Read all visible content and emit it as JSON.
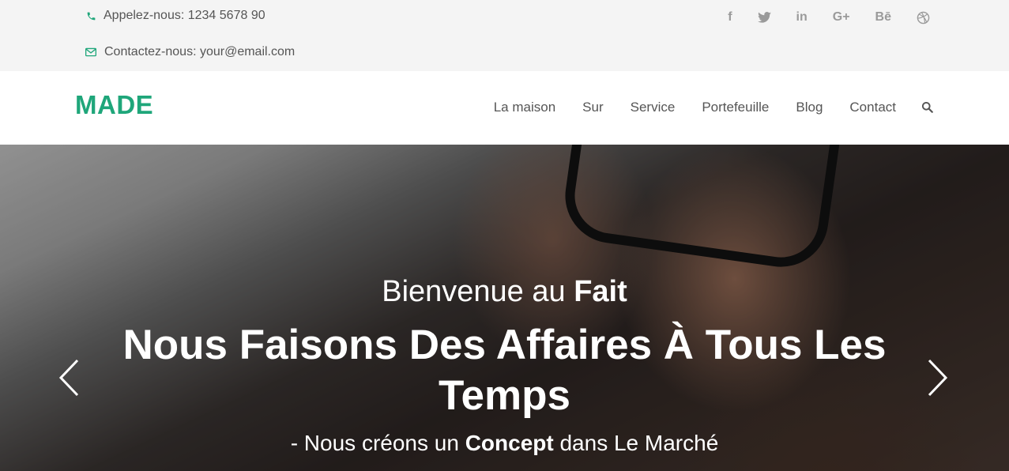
{
  "topbar": {
    "phone_label": "Appelez-nous: 1234 5678 90",
    "email_label": "Contactez-nous: your@email.com",
    "social": [
      {
        "icon": "facebook-icon",
        "glyph": "f"
      },
      {
        "icon": "twitter-icon",
        "glyph": ""
      },
      {
        "icon": "linkedin-icon",
        "glyph": "in"
      },
      {
        "icon": "google-plus-icon",
        "glyph": "G+"
      },
      {
        "icon": "behance-icon",
        "glyph": "Bē"
      },
      {
        "icon": "dribbble-icon",
        "glyph": ""
      }
    ]
  },
  "nav": {
    "logo": "MADE",
    "items": [
      "La maison",
      "Sur",
      "Service",
      "Portefeuille",
      "Blog",
      "Contact"
    ]
  },
  "hero": {
    "welcome_prefix": "Bienvenue au ",
    "welcome_bold": "Fait",
    "headline_line1": "Nous Faisons Des Affaires À Tous Les",
    "headline_line2": "Temps",
    "tagline_prefix": "- Nous créons un ",
    "tagline_bold": "Concept",
    "tagline_suffix": " dans Le Marché"
  },
  "colors": {
    "brand": "#1fa67a",
    "nav_text": "#555555",
    "social_icon": "#9a9a9a"
  }
}
